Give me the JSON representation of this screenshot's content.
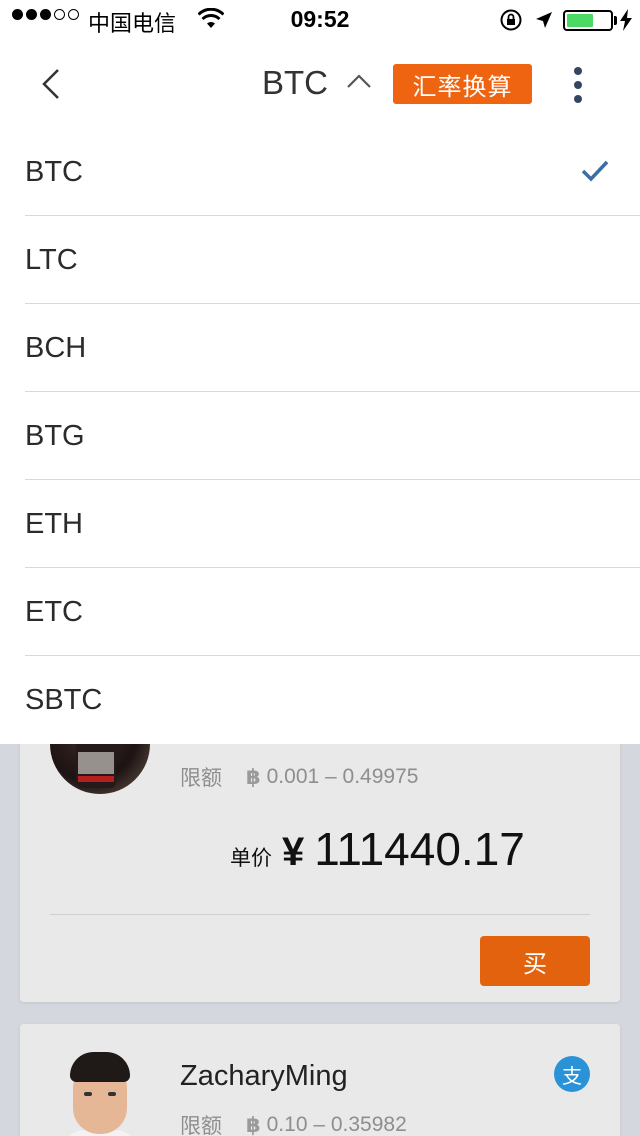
{
  "status_bar": {
    "carrier": "中国电信",
    "time": "09:52",
    "battery_level": 0.62
  },
  "nav": {
    "title": "BTC",
    "rate_button": "汇率换算"
  },
  "dropdown": {
    "selected": "BTC",
    "items": [
      "BTC",
      "LTC",
      "BCH",
      "BTG",
      "ETH",
      "ETC",
      "SBTC"
    ]
  },
  "offers": [
    {
      "limit_label": "限额",
      "limit_range": "0.001 – 0.49975",
      "price_label": "单价",
      "currency_symbol": "¥",
      "price": "111440.17",
      "action": "买"
    },
    {
      "user": "ZacharyMing",
      "payment_badge": "支",
      "limit_label": "限额",
      "limit_range": "0.10 – 0.35982"
    }
  ],
  "colors": {
    "accent_orange": "#ef6410",
    "check_blue": "#3d6ea3",
    "pay_badge_blue": "#2a93d8",
    "page_bg": "#d4d7dd"
  }
}
